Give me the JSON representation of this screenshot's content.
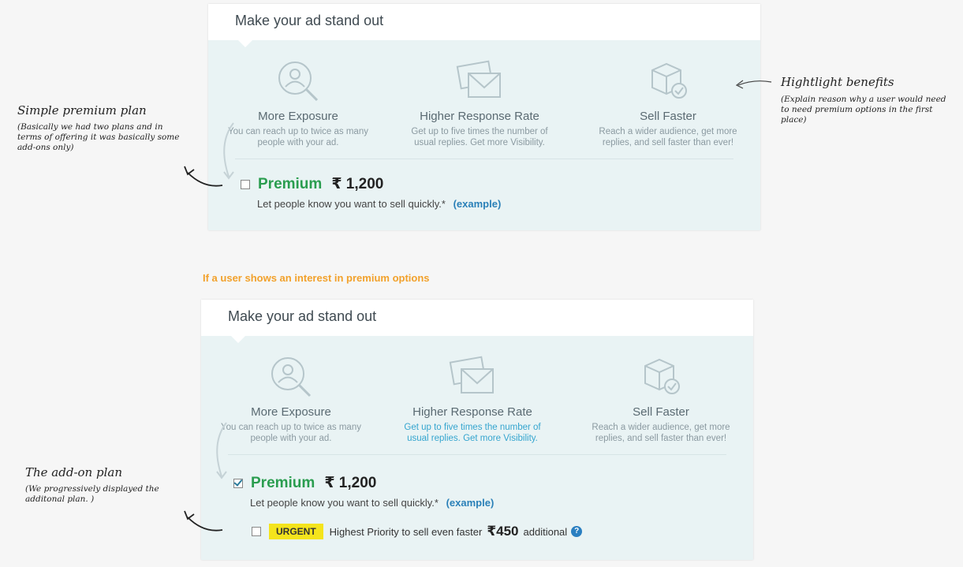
{
  "top_card": {
    "title": "Make your ad stand out",
    "benefits": [
      {
        "icon": "search-user-icon",
        "title": "More Exposure",
        "desc": "You can reach up to twice as many people with your ad."
      },
      {
        "icon": "envelopes-icon",
        "title": "Higher Response Rate",
        "desc": "Get up to five times the number of usual replies. Get more Visibility."
      },
      {
        "icon": "box-check-icon",
        "title": "Sell Faster",
        "desc": "Reach a wider audience, get more replies, and sell faster than ever!"
      }
    ],
    "plan": {
      "name": "Premium",
      "price": "₹ 1,200",
      "checked": false,
      "tagline": "Let people know you want to sell quickly.*",
      "example": "(example)"
    }
  },
  "section_label": "If a user shows an interest in premium options",
  "bottom_card": {
    "title": "Make your ad stand out",
    "benefits": [
      {
        "icon": "search-user-icon",
        "title": "More Exposure",
        "desc": "You can reach up to twice as many people with your ad."
      },
      {
        "icon": "envelopes-icon",
        "title": "Higher Response Rate",
        "desc": "Get up to five times the number of usual replies. Get more Visibility."
      },
      {
        "icon": "box-check-icon",
        "title": "Sell Faster",
        "desc": "Reach a wider audience, get more replies, and sell faster than ever!"
      }
    ],
    "plan": {
      "name": "Premium",
      "price": "₹ 1,200",
      "checked": true,
      "tagline": "Let people know you want to sell quickly.*",
      "example": "(example)"
    },
    "addon": {
      "badge": "URGENT",
      "text": "Highest Priority to sell even faster",
      "price": "₹450",
      "suffix": "additional",
      "help": "?",
      "checked": false
    }
  },
  "annotations": {
    "simple_plan": {
      "title": "Simple premium plan",
      "body": "(Basically we had two plans and in terms of offering it was basically some add-ons only)"
    },
    "benefits": {
      "title": "Hightlight benefits",
      "body": "(Explain reason why a user would need to need premium options in the first place)"
    },
    "addon_plan": {
      "title": "The add-on plan",
      "body": "(We progressively displayed the additonal plan. )"
    }
  },
  "colors": {
    "card_bg": "#e9f3f4",
    "premium_green": "#2a9d4f",
    "link_blue": "#2a80b8",
    "urgent_yellow": "#f4e41c",
    "label_orange": "#f2a12b"
  }
}
